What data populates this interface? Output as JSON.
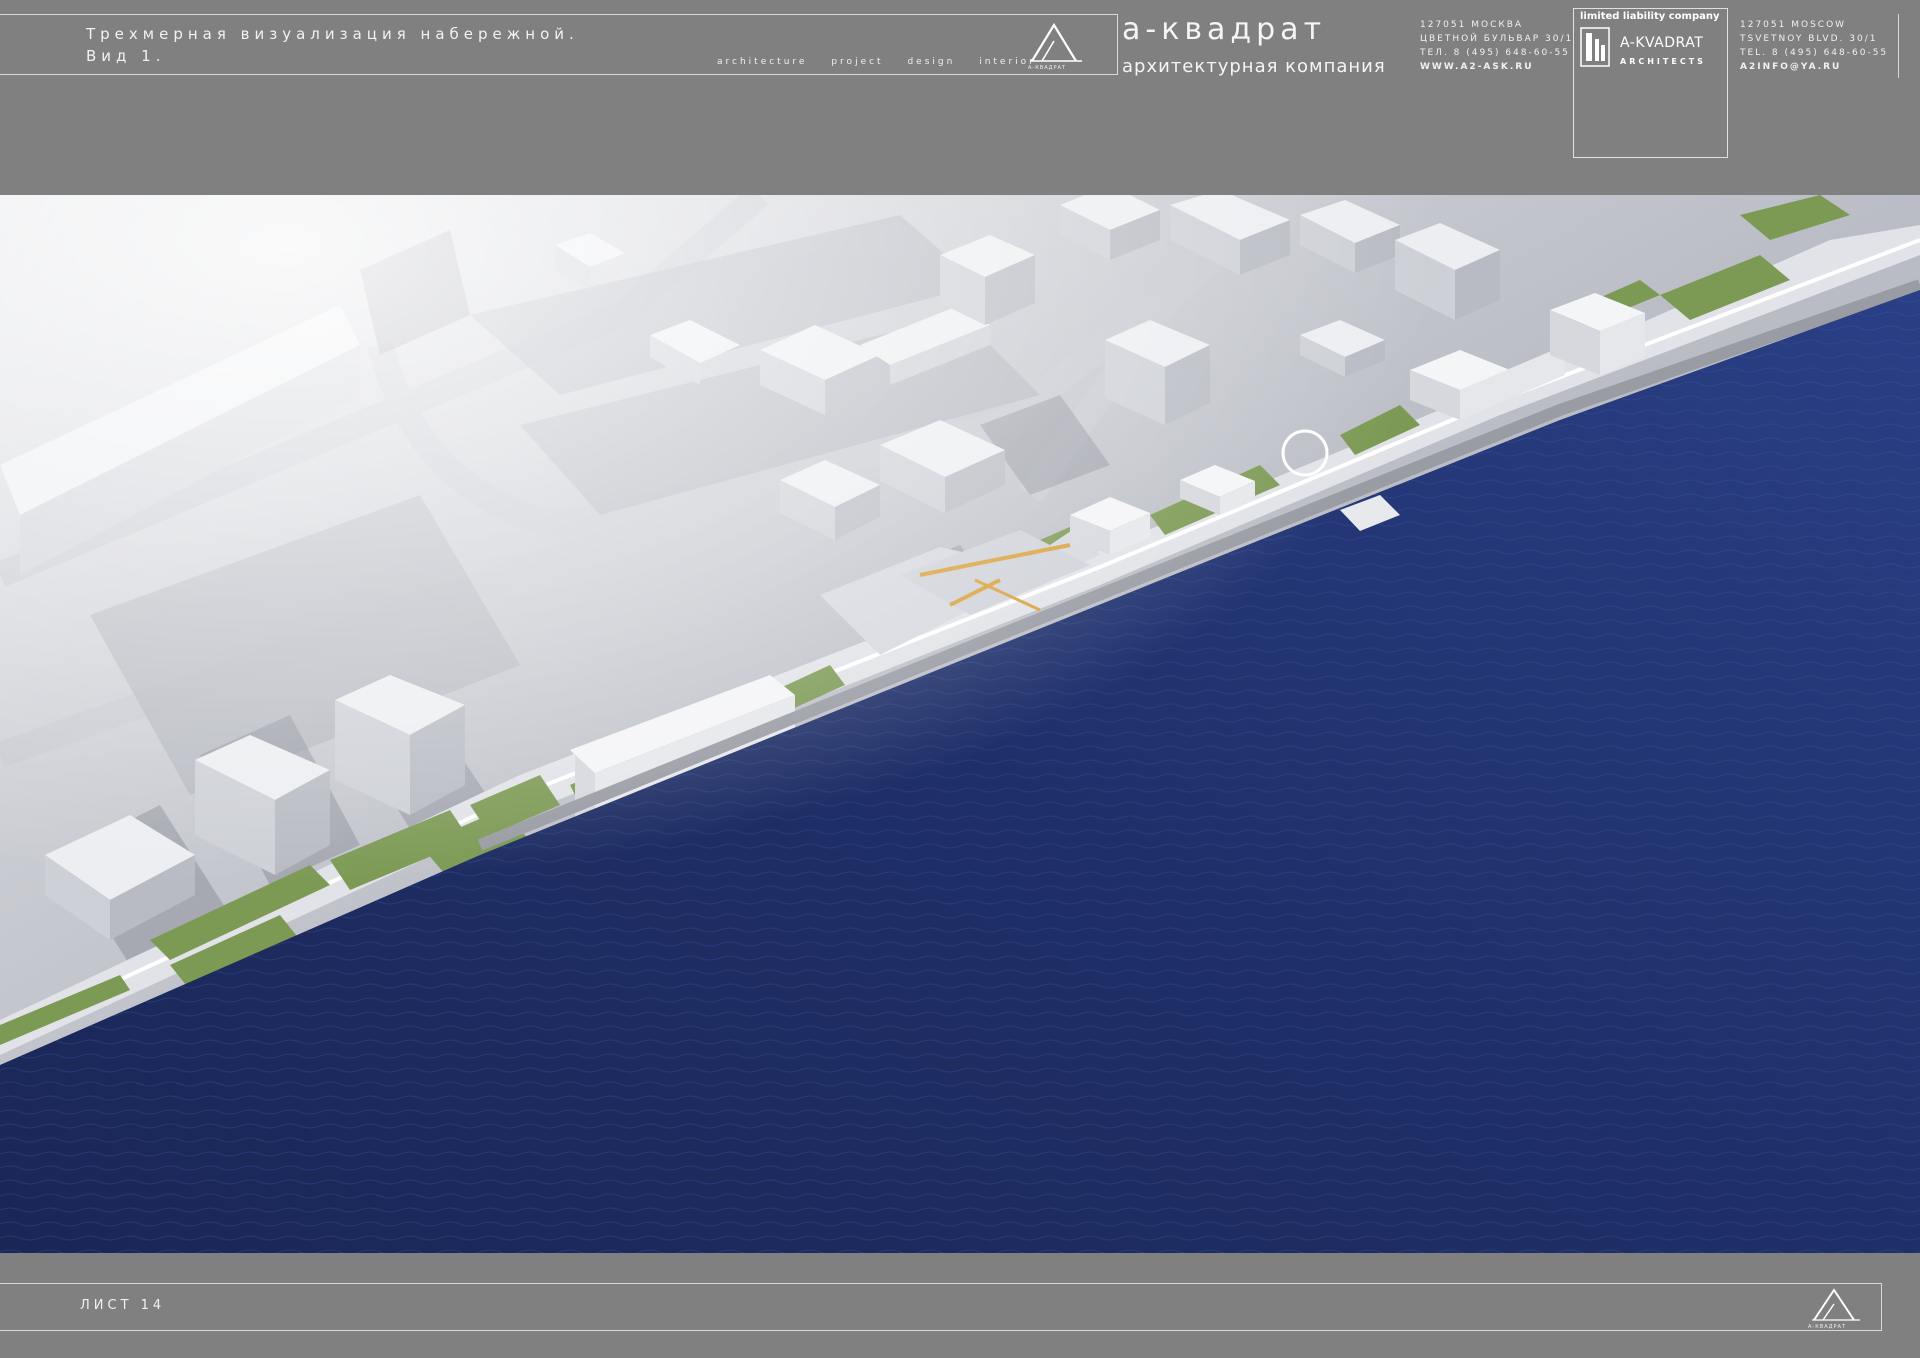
{
  "header": {
    "title_line1": "Трехмерная визуализация набережной.",
    "title_line2": "Вид 1.",
    "services": [
      "architecture",
      "project",
      "design",
      "interior"
    ],
    "logo_caption": "А-КВАДРАТ",
    "brand_name": "а-квадрат",
    "brand_subtitle": "архитектурная компания",
    "contacts_ru": {
      "postal": "127051 МОСКВА",
      "address": "ЦВЕТНОЙ БУЛЬВАР 30/1",
      "phone": "ТЕЛ. 8 (495) 648-60-55",
      "web": "WWW.A2-ASK.RU"
    },
    "company_box": {
      "llc": "limited liability company",
      "name": "A-KVADRAT",
      "subtitle": "ARCHITECTS"
    },
    "contacts_en": {
      "postal": "127051 MOSCOW",
      "address": "TSVETNOY BLVD. 30/1",
      "phone": "TEL. 8 (495) 648-60-55",
      "email": "A2INFO@YA.RU"
    }
  },
  "render": {
    "subject": "aerial view of embankment",
    "colors": {
      "water": "#1f2f64",
      "ground": "#b9bcc4",
      "lawn": "#7d9a55",
      "buildings": "#dcdde2",
      "playground": "#d9a23a"
    }
  },
  "footer": {
    "sheet_label": "ЛИСТ 14",
    "logo_caption": "А-КВАДРАТ"
  },
  "style": {
    "frame_bg": "#808080",
    "frame_lines": "#d8d8d8",
    "text": "#ffffff"
  }
}
